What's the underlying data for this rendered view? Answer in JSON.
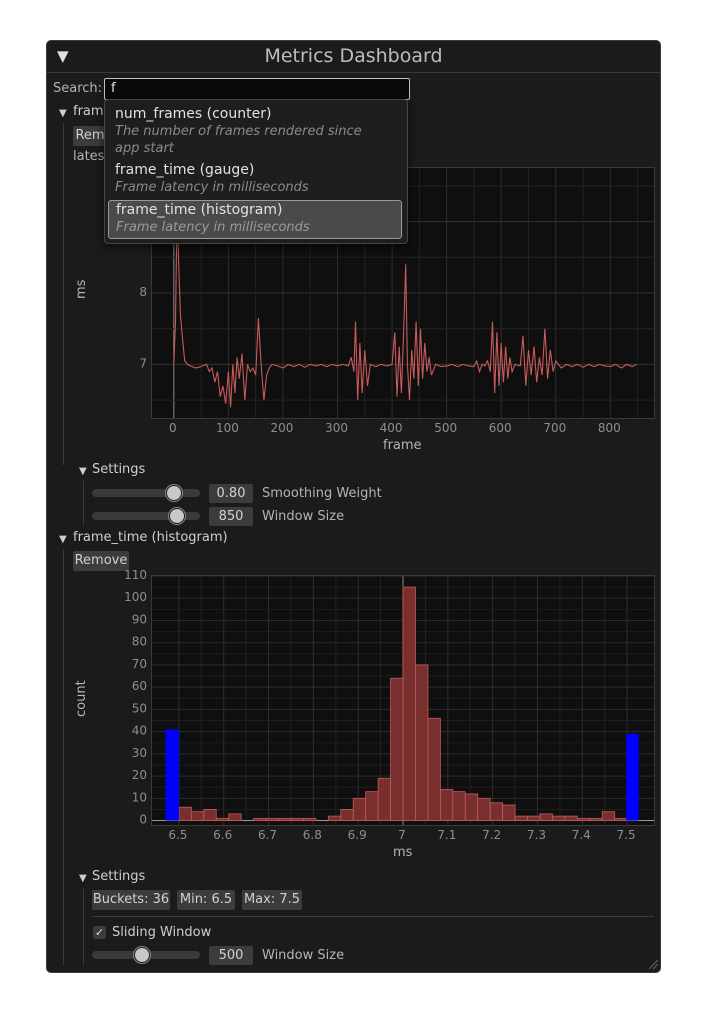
{
  "window": {
    "title": "Metrics Dashboard"
  },
  "search": {
    "label": "Search:",
    "value": "f"
  },
  "dropdown": {
    "options": [
      {
        "title": "num_frames (counter)",
        "desc_line1": "The number of frames rendered since",
        "desc_line2": "app start"
      },
      {
        "title": "frame_time (gauge)",
        "desc_line1": "Frame latency in milliseconds"
      },
      {
        "title": "frame_time (histogram)",
        "desc_line1": "Frame latency in milliseconds",
        "selected": true
      }
    ]
  },
  "gauge_panel": {
    "header": "frame",
    "remove_label": "Rem",
    "latest_label": "latest",
    "settings_label": "Settings",
    "smoothing": {
      "value": "0.80",
      "label": "Smoothing Weight",
      "level": 0.8
    },
    "window": {
      "value": "850",
      "label": "Window Size",
      "level": 0.85
    }
  },
  "histogram_panel": {
    "header": "frame_time (histogram)",
    "remove_label": "Remove",
    "settings_label": "Settings",
    "buckets_label": "Buckets: 36",
    "min_label": "Min: 6.5",
    "max_label": "Max: 7.5",
    "sliding_window_label": "Sliding Window",
    "sliding_window_checked": true,
    "window": {
      "value": "500",
      "label": "Window Size",
      "level": 0.45
    }
  },
  "colors": {
    "line": "#c85a5a",
    "bar": "#7a2f2f",
    "bar_edge": "#c15b5b",
    "marker": "#0000ff"
  },
  "chart_data": [
    {
      "type": "line",
      "xlabel": "frame",
      "ylabel": "ms",
      "xlim": [
        -40,
        880
      ],
      "ylim": [
        6.25,
        9.75
      ],
      "xticks": [
        0,
        100,
        200,
        300,
        400,
        500,
        600,
        700,
        800
      ],
      "yticks": [
        7,
        8
      ],
      "series": [
        {
          "points": [
            [
              0,
              7.0
            ],
            [
              3,
              7.6
            ],
            [
              6,
              9.2
            ],
            [
              9,
              8.4
            ],
            [
              12,
              7.7
            ],
            [
              16,
              7.35
            ],
            [
              20,
              7.05
            ],
            [
              25,
              7.0
            ],
            [
              30,
              6.98
            ],
            [
              40,
              6.95
            ],
            [
              50,
              6.97
            ],
            [
              60,
              7.0
            ],
            [
              65,
              6.9
            ],
            [
              70,
              6.95
            ],
            [
              75,
              6.75
            ],
            [
              80,
              6.9
            ],
            [
              85,
              6.55
            ],
            [
              90,
              6.7
            ],
            [
              95,
              6.45
            ],
            [
              100,
              6.9
            ],
            [
              104,
              6.4
            ],
            [
              108,
              7.0
            ],
            [
              112,
              6.6
            ],
            [
              116,
              7.1
            ],
            [
              120,
              6.8
            ],
            [
              125,
              7.15
            ],
            [
              130,
              6.5
            ],
            [
              135,
              7.0
            ],
            [
              140,
              6.9
            ],
            [
              145,
              6.95
            ],
            [
              150,
              6.85
            ],
            [
              155,
              7.65
            ],
            [
              160,
              7.0
            ],
            [
              165,
              6.5
            ],
            [
              170,
              6.85
            ],
            [
              175,
              6.95
            ],
            [
              180,
              7.0
            ],
            [
              190,
              6.98
            ],
            [
              200,
              6.95
            ],
            [
              210,
              7.0
            ],
            [
              220,
              6.97
            ],
            [
              230,
              7.0
            ],
            [
              240,
              6.96
            ],
            [
              250,
              7.0
            ],
            [
              260,
              6.98
            ],
            [
              270,
              7.0
            ],
            [
              280,
              6.97
            ],
            [
              290,
              7.0
            ],
            [
              300,
              6.98
            ],
            [
              310,
              7.0
            ],
            [
              320,
              6.98
            ],
            [
              325,
              7.1
            ],
            [
              330,
              6.9
            ],
            [
              333,
              7.6
            ],
            [
              337,
              6.5
            ],
            [
              341,
              7.3
            ],
            [
              345,
              6.6
            ],
            [
              350,
              7.2
            ],
            [
              355,
              6.7
            ],
            [
              360,
              7.0
            ],
            [
              370,
              6.97
            ],
            [
              380,
              7.0
            ],
            [
              390,
              6.98
            ],
            [
              400,
              7.0
            ],
            [
              405,
              7.45
            ],
            [
              409,
              6.55
            ],
            [
              413,
              7.25
            ],
            [
              417,
              6.6
            ],
            [
              421,
              7.4
            ],
            [
              425,
              8.4
            ],
            [
              428,
              7.0
            ],
            [
              432,
              6.5
            ],
            [
              436,
              7.2
            ],
            [
              440,
              6.8
            ],
            [
              444,
              7.6
            ],
            [
              448,
              6.7
            ],
            [
              452,
              7.5
            ],
            [
              456,
              6.8
            ],
            [
              460,
              7.3
            ],
            [
              464,
              6.9
            ],
            [
              468,
              7.1
            ],
            [
              472,
              6.85
            ],
            [
              480,
              7.0
            ],
            [
              490,
              6.97
            ],
            [
              500,
              6.98
            ],
            [
              510,
              7.0
            ],
            [
              520,
              6.97
            ],
            [
              530,
              7.0
            ],
            [
              540,
              6.98
            ],
            [
              550,
              6.97
            ],
            [
              555,
              7.05
            ],
            [
              560,
              6.9
            ],
            [
              565,
              7.0
            ],
            [
              570,
              6.98
            ],
            [
              575,
              7.05
            ],
            [
              580,
              6.9
            ],
            [
              584,
              7.6
            ],
            [
              588,
              6.6
            ],
            [
              592,
              7.45
            ],
            [
              596,
              6.7
            ],
            [
              600,
              7.3
            ],
            [
              604,
              6.75
            ],
            [
              608,
              7.25
            ],
            [
              612,
              6.8
            ],
            [
              616,
              7.1
            ],
            [
              620,
              6.9
            ],
            [
              625,
              7.0
            ],
            [
              635,
              6.98
            ],
            [
              640,
              7.4
            ],
            [
              645,
              6.7
            ],
            [
              650,
              7.2
            ],
            [
              655,
              6.85
            ],
            [
              660,
              7.25
            ],
            [
              665,
              6.75
            ],
            [
              670,
              7.1
            ],
            [
              675,
              6.85
            ],
            [
              680,
              7.5
            ],
            [
              685,
              6.8
            ],
            [
              690,
              7.2
            ],
            [
              695,
              6.9
            ],
            [
              700,
              7.05
            ],
            [
              710,
              6.95
            ],
            [
              720,
              7.0
            ],
            [
              730,
              6.97
            ],
            [
              740,
              7.0
            ],
            [
              750,
              6.96
            ],
            [
              760,
              7.0
            ],
            [
              770,
              6.97
            ],
            [
              780,
              7.0
            ],
            [
              790,
              6.98
            ],
            [
              800,
              6.97
            ],
            [
              810,
              7.0
            ],
            [
              820,
              6.95
            ],
            [
              830,
              7.0
            ],
            [
              840,
              6.97
            ],
            [
              848,
              7.0
            ]
          ]
        }
      ]
    },
    {
      "type": "bar",
      "xlabel": "ms",
      "ylabel": "count",
      "xlim": [
        6.44,
        7.56
      ],
      "ylim": [
        -2,
        110
      ],
      "xticks": [
        6.5,
        6.6,
        6.7,
        6.8,
        6.9,
        7.0,
        7.1,
        7.2,
        7.3,
        7.4,
        7.5
      ],
      "xtick_labels": [
        "6.5",
        "6.6",
        "6.7",
        "6.8",
        "6.9",
        "7",
        "7.1",
        "7.2",
        "7.3",
        "7.4",
        "7.5"
      ],
      "yticks": [
        0,
        10,
        20,
        30,
        40,
        50,
        60,
        70,
        80,
        90,
        100,
        110
      ],
      "bucket_width": 0.02778,
      "bucket_start": 6.5,
      "values": [
        6,
        4,
        5,
        1,
        3,
        0,
        1,
        1,
        1,
        1,
        1,
        0,
        2,
        5,
        10,
        13,
        19,
        64,
        105,
        70,
        46,
        14,
        13,
        12,
        10,
        8,
        7,
        2,
        2,
        3,
        2,
        2,
        1,
        1,
        4,
        1
      ],
      "outliers": {
        "below": 41,
        "above": 39
      }
    }
  ]
}
